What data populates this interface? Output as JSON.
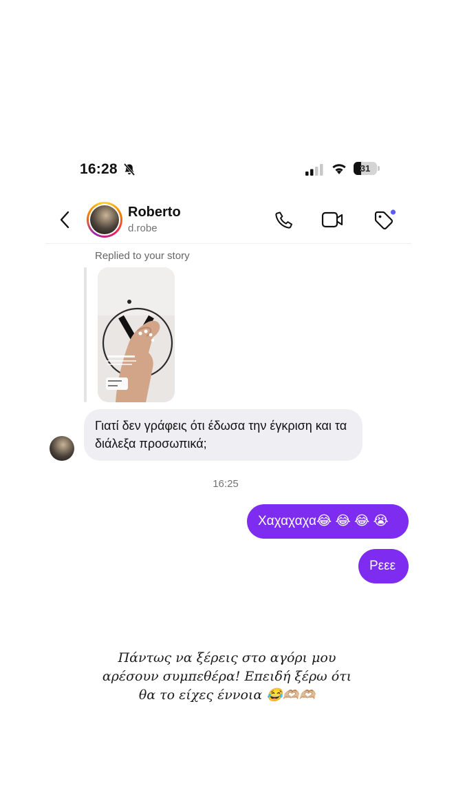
{
  "status_bar": {
    "time": "16:28",
    "battery_level": 31,
    "battery_label": "31",
    "icons": [
      "bell-muted-icon",
      "signal-icon",
      "wifi-icon",
      "battery-icon"
    ]
  },
  "header": {
    "name": "Roberto",
    "username": "d.robe",
    "icons": [
      "back-chevron-icon",
      "phone-icon",
      "video-camera-icon",
      "tag-icon"
    ],
    "notification_dot_color": "#5b5bf5"
  },
  "messages": {
    "reply_label": "Replied to your story",
    "incoming_text": "Γιατί δεν γράφεις ότι έδωσα την έγκριση και τα διάλεξα προσωπικά;",
    "timestamp": "16:25",
    "outgoing": [
      "Χαχαχαχα😂 😂 😂 😭",
      "Ρεεε"
    ],
    "outgoing_color": "#7d2cf0"
  },
  "caption": {
    "lines": [
      "Πάντως να ξέρεις στο αγόρι μου",
      "αρέσουν συμπεθέρα! Επειδή ξέρω ότι",
      "θα το είχες έννοια 😂🫶🏼🫶🏼"
    ]
  }
}
